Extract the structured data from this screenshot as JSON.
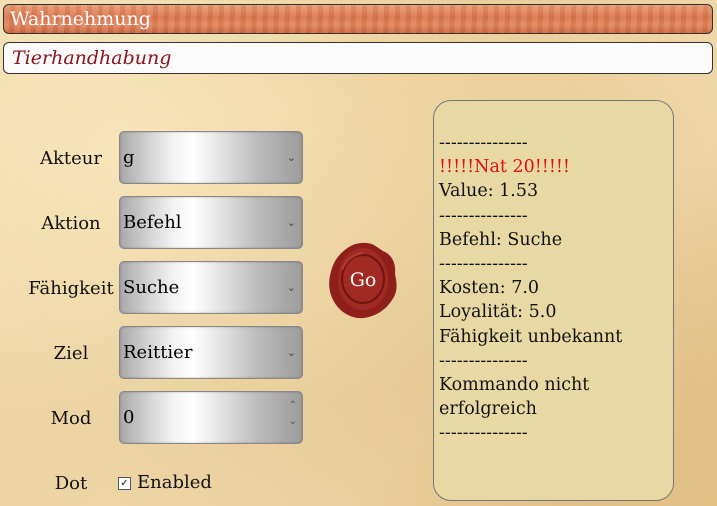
{
  "header": {
    "title": "Wahrnehmung"
  },
  "subheader": {
    "title": "Tierhandhabung"
  },
  "form": {
    "akteur": {
      "label": "Akteur",
      "value": "g"
    },
    "aktion": {
      "label": "Aktion",
      "value": "Befehl"
    },
    "faehigkeit": {
      "label": "Fähigkeit",
      "value": "Suche"
    },
    "ziel": {
      "label": "Ziel",
      "value": "Reittier"
    },
    "mod": {
      "label": "Mod",
      "value": "0"
    },
    "dot": {
      "label": "Dot",
      "checkbox_label": "Enabled",
      "checked": true
    }
  },
  "go_button": {
    "label": "Go"
  },
  "output": {
    "lines": [
      "---------------",
      "!!!!!Nat 20!!!!!",
      "Value: 1.53",
      "---------------",
      "Befehl: Suche",
      "---------------",
      "Kosten: 7.0",
      "Loyalität: 5.0",
      "Fähigkeit unbekannt",
      "---------------",
      "Kommando nicht erfolgreich",
      "---------------"
    ]
  },
  "colors": {
    "header_bar": "#d9754c",
    "subheader_text": "#8b1520",
    "nat20_text": "#e01010",
    "output_bg": "#e8d9a4",
    "wax_seal": "#8e1f1a"
  },
  "icons": {
    "select_arrow": "chevron-down-icon",
    "spinner": "up-down-arrows-icon",
    "check": "checkmark-icon"
  }
}
